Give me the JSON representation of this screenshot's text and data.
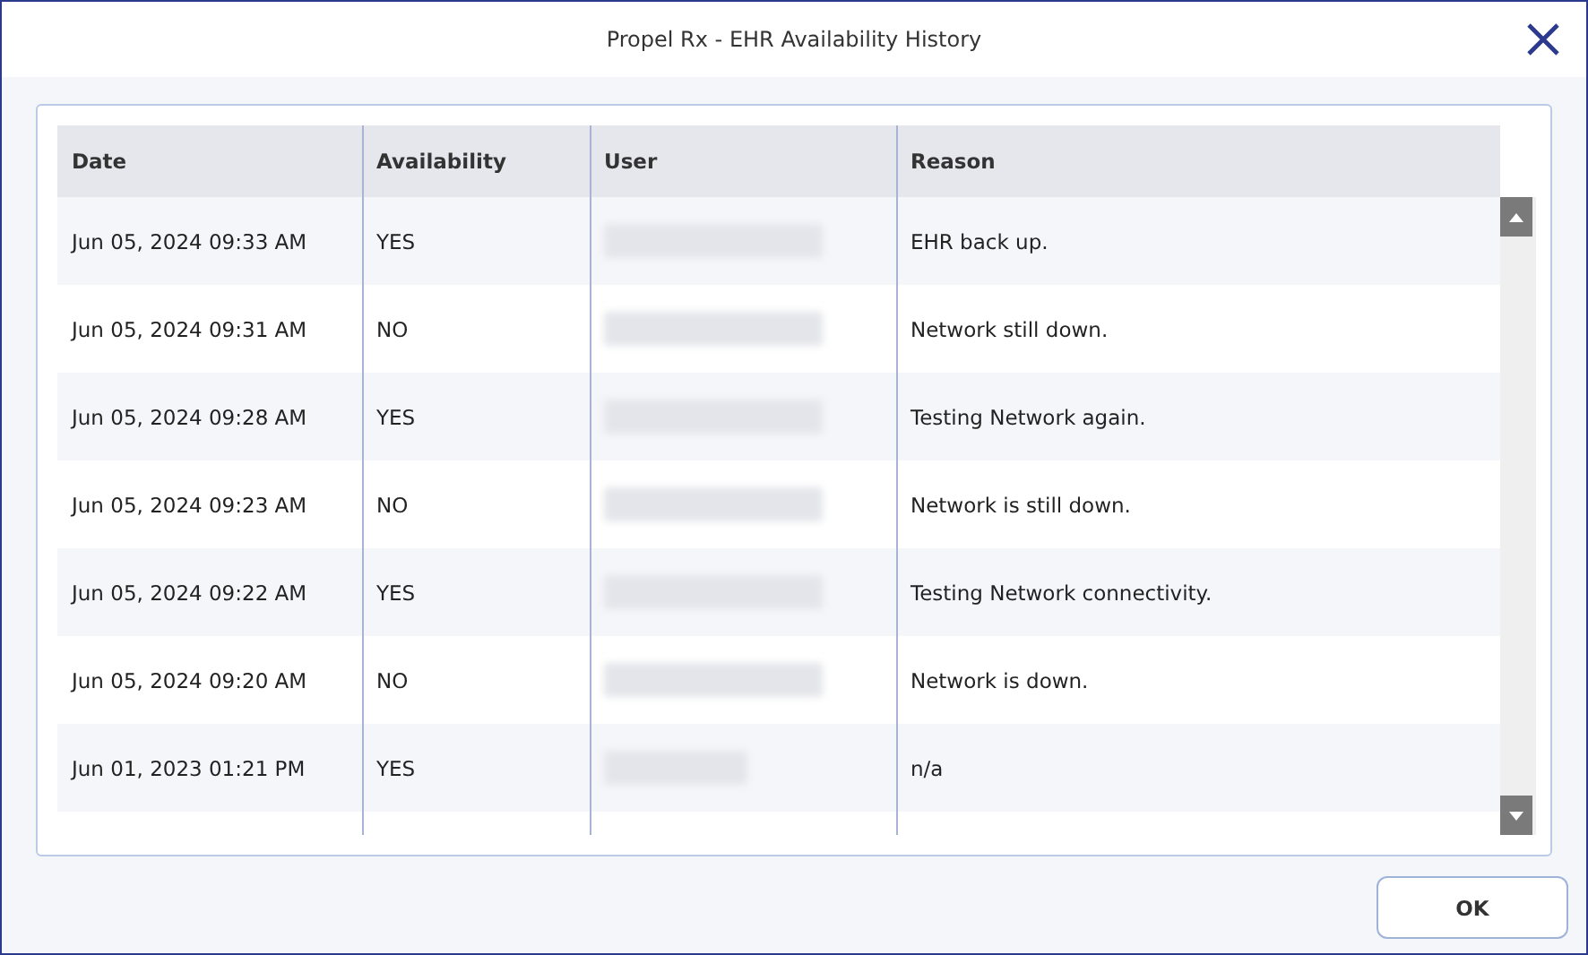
{
  "window": {
    "title": "Propel Rx - EHR Availability History"
  },
  "table": {
    "columns": [
      "Date",
      "Availability",
      "User",
      "Reason"
    ],
    "rows": [
      {
        "date": "Jun 05, 2024 09:33 AM",
        "availability": "YES",
        "reason": "EHR back up."
      },
      {
        "date": "Jun 05, 2024 09:31 AM",
        "availability": "NO",
        "reason": "Network still down."
      },
      {
        "date": "Jun 05, 2024 09:28 AM",
        "availability": "YES",
        "reason": "Testing Network again."
      },
      {
        "date": "Jun 05, 2024 09:23 AM",
        "availability": "NO",
        "reason": "Network is still down."
      },
      {
        "date": "Jun 05, 2024 09:22 AM",
        "availability": "YES",
        "reason": "Testing Network connectivity."
      },
      {
        "date": "Jun 05, 2024 09:20 AM",
        "availability": "NO",
        "reason": "Network is down."
      },
      {
        "date": "Jun 01, 2023 01:21 PM",
        "availability": "YES",
        "reason": "n/a"
      }
    ]
  },
  "buttons": [
    "OK"
  ]
}
